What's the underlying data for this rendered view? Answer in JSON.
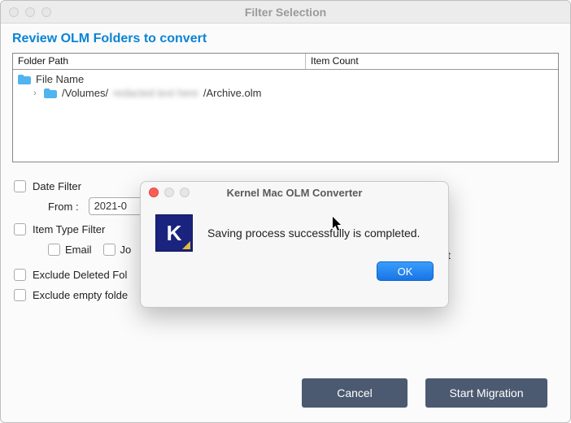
{
  "window": {
    "title": "Filter Selection"
  },
  "heading": "Review OLM Folders to convert",
  "folder_table": {
    "col1": "Folder Path",
    "col2": "Item Count",
    "root_label": "File Name",
    "path_prefix": "/Volumes/",
    "path_blurred": "redacted text here",
    "path_suffix": "/Archive.olm"
  },
  "filters": {
    "date_filter_label": "Date Filter",
    "from_label": "From :",
    "from_value": "2021-0",
    "item_type_label": "Item Type Filter",
    "types": {
      "email": "Email",
      "journal_frag": "Jo",
      "right_frag": "nt"
    },
    "exclude_deleted": "Exclude Deleted Fol",
    "exclude_empty": "Exclude empty folde"
  },
  "buttons": {
    "cancel": "Cancel",
    "start": "Start Migration"
  },
  "modal": {
    "title": "Kernel Mac OLM Converter",
    "icon_letter": "K",
    "message": "Saving process successfully is completed.",
    "ok": "OK"
  }
}
